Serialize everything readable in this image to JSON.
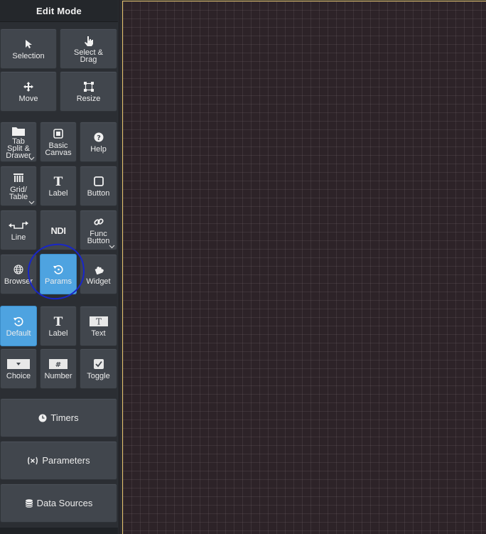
{
  "header": {
    "title": "Edit Mode"
  },
  "modes": {
    "selection": "Selection",
    "select_drag": "Select &\nDrag",
    "move": "Move",
    "resize": "Resize"
  },
  "widgets": {
    "tab_split": "Tab\nSplit &\nDrawer",
    "basic_canvas": "Basic\nCanvas",
    "help": "Help",
    "grid_table": "Grid/\nTable",
    "label": "Label",
    "button": "Button",
    "line": "Line",
    "ndi": "NDI",
    "func_button": "Func\nButton",
    "browser": "Browser",
    "params": "Params",
    "widget": "Widget"
  },
  "params": {
    "default": "Default",
    "label": "Label",
    "text": "Text",
    "choice": "Choice",
    "number": "Number",
    "toggle": "Toggle"
  },
  "panels": {
    "timers": "Timers",
    "parameters": "Parameters",
    "data_sources": "Data Sources"
  },
  "colors": {
    "active": "#4ea3e0",
    "annotation": "#1826c9",
    "canvas_border": "#e2c06a"
  }
}
